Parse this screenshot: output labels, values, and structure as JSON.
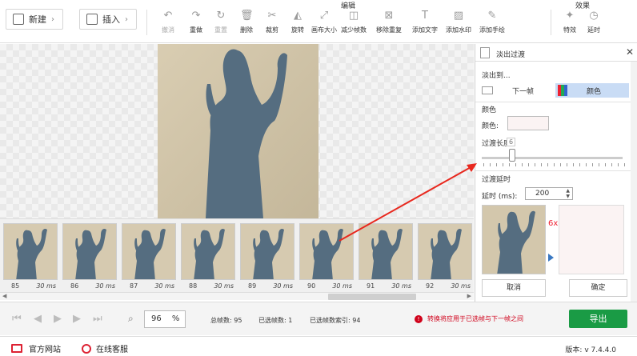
{
  "toolbar": {
    "new_label": "新建",
    "insert_label": "插入",
    "group_edit": "编辑",
    "group_effect": "效果",
    "tools": [
      {
        "label": "撤消",
        "icon": "undo-icon",
        "dim": true
      },
      {
        "label": "重做",
        "icon": "redo-icon",
        "dim": false
      },
      {
        "label": "重置",
        "icon": "reset-icon",
        "dim": true
      },
      {
        "label": "删除",
        "icon": "delete-icon",
        "dim": false
      },
      {
        "label": "裁剪",
        "icon": "crop-icon",
        "dim": false
      },
      {
        "label": "旋转",
        "icon": "rotate-icon",
        "dim": false
      },
      {
        "label": "画布大小",
        "icon": "canvas-size-icon",
        "dim": false
      },
      {
        "label": "减少帧数",
        "icon": "reduce-frames-icon",
        "dim": false
      },
      {
        "label": "移除重复",
        "icon": "remove-duplicates-icon",
        "dim": false
      },
      {
        "label": "添加文字",
        "icon": "add-text-icon",
        "dim": false
      },
      {
        "label": "添加水印",
        "icon": "add-watermark-icon",
        "dim": false
      },
      {
        "label": "添加手绘",
        "icon": "add-drawing-icon",
        "dim": false
      }
    ],
    "effects": [
      {
        "label": "特效",
        "icon": "effects-icon"
      },
      {
        "label": "延时",
        "icon": "delay-icon"
      }
    ]
  },
  "frames": [
    {
      "num": "85",
      "ms": "30 ms"
    },
    {
      "num": "86",
      "ms": "30 ms"
    },
    {
      "num": "87",
      "ms": "30 ms"
    },
    {
      "num": "88",
      "ms": "30 ms"
    },
    {
      "num": "89",
      "ms": "30 ms"
    },
    {
      "num": "90",
      "ms": "30 ms"
    },
    {
      "num": "91",
      "ms": "30 ms"
    },
    {
      "num": "92",
      "ms": "30 ms"
    }
  ],
  "panel": {
    "title": "淡出过渡",
    "fade_to_label": "淡出到...",
    "option_next_frame": "下一帧",
    "option_color": "颜色",
    "color_section": "颜色",
    "color_label": "颜色:",
    "color_value": "#fbf3f3",
    "transition_length_label": "过渡长度",
    "slider_value": "6",
    "delay_section": "过渡延时",
    "delay_label": "延时 (ms):",
    "delay_value": "200",
    "preview_count": "6x",
    "cancel_label": "取消",
    "ok_label": "确定"
  },
  "bottom": {
    "zoom_value": "96",
    "zoom_unit": "%",
    "total_frames": "总帧数: 95",
    "selected_frames": "已选帧数: 1",
    "selected_index": "已选帧数索引: 94",
    "warning": "转换将应用于已选帧与下一帧之间",
    "export_label": "导出"
  },
  "status": {
    "website": "官方网站",
    "support": "在线客服",
    "version": "版本: v 7.4.4.0"
  },
  "colors": {
    "accent": "#1a9b45",
    "selected_option": "#c9dcf5",
    "warning": "#d0021b",
    "arrow": "#e8281e"
  }
}
